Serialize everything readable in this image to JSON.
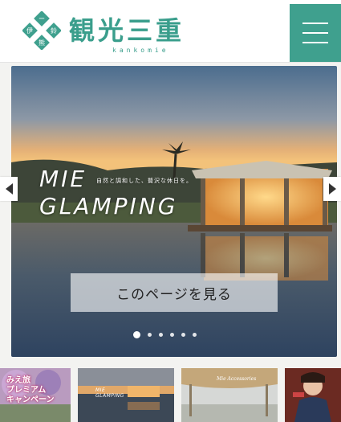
{
  "header": {
    "logo_text": "観光三重",
    "logo_sub": "kankomie",
    "brand_color": "#3fa08e",
    "menu_icon": "hamburger-icon"
  },
  "hero": {
    "title_line1": "MIE",
    "title_line2": "GLAMPING",
    "subtitle": "自然と調和した、贅沢な休日を。",
    "cta_label": "このページを見る",
    "slide_count": 6,
    "active_slide": 1
  },
  "nav": {
    "prev_icon": "triangle-left-icon",
    "next_icon": "triangle-right-icon"
  },
  "thumbnails": [
    {
      "label": "みえ旅\nプレミアム\nキャンペーン"
    },
    {
      "label_line1": "MIE",
      "label_line2": "GLAMPING"
    },
    {
      "label": "Mie Accessories"
    },
    {
      "label": ""
    }
  ]
}
